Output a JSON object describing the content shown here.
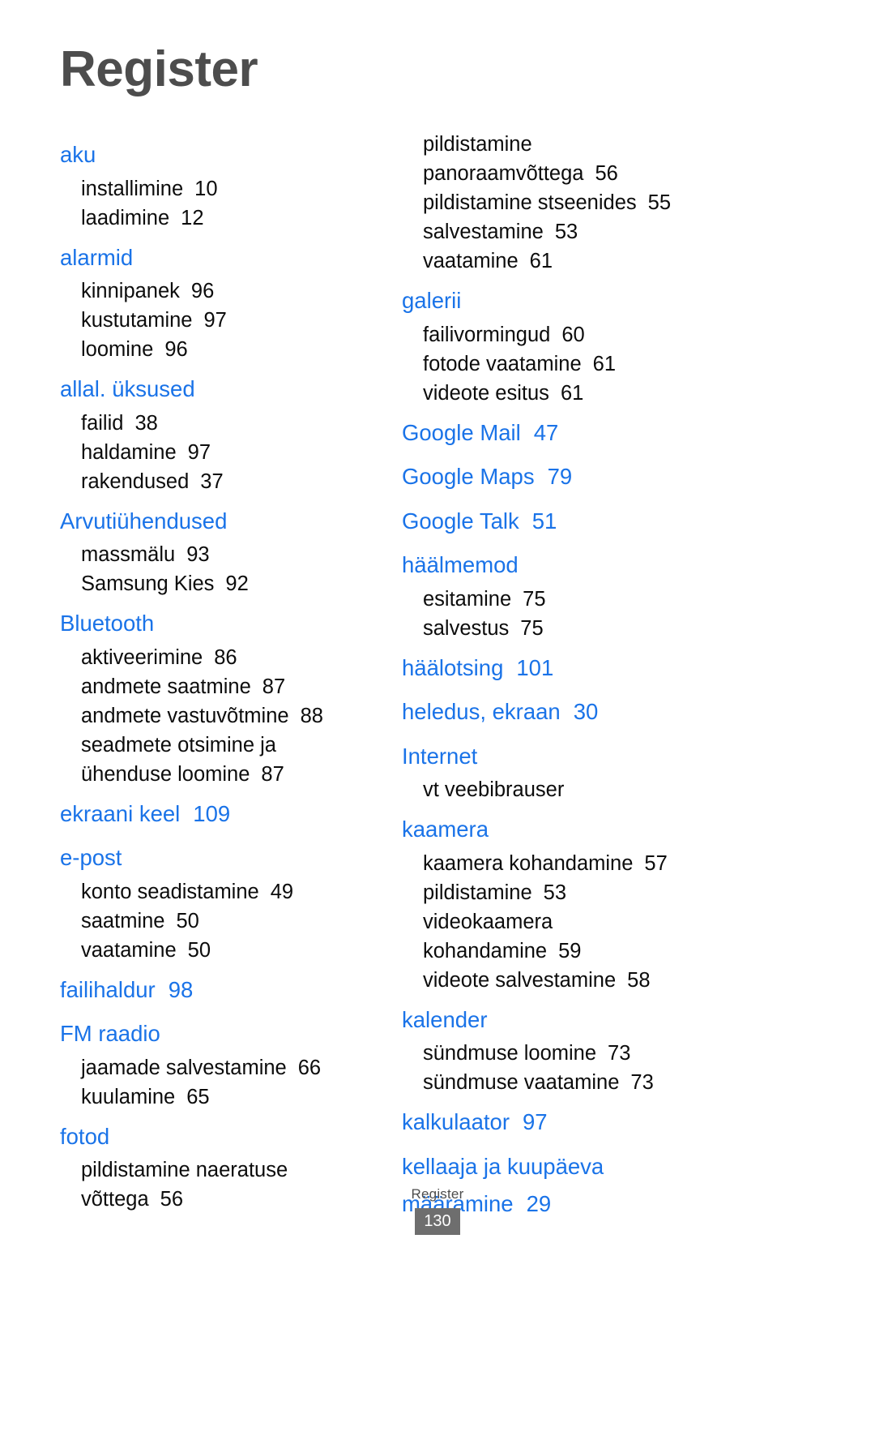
{
  "document": {
    "title": "Register",
    "footer": {
      "label": "Register",
      "page_number": "130"
    },
    "colors": {
      "heading_blue": "#1a73e8",
      "title_gray": "#4d4d4d",
      "body_black": "#0c0c0c",
      "badge_gray": "#6e6e6e",
      "background": "#ffffff"
    }
  },
  "columns": [
    {
      "name": "left-column",
      "groups": [
        {
          "heading": "aku",
          "heading_page": "",
          "subentries": [
            {
              "label": "installimine",
              "page": "10"
            },
            {
              "label": "laadimine",
              "page": "12"
            }
          ]
        },
        {
          "heading": "alarmid",
          "heading_page": "",
          "subentries": [
            {
              "label": "kinnipanek",
              "page": "96"
            },
            {
              "label": "kustutamine",
              "page": "97"
            },
            {
              "label": "loomine",
              "page": "96"
            }
          ]
        },
        {
          "heading": "allal. üksused",
          "heading_page": "",
          "subentries": [
            {
              "label": "failid",
              "page": "38"
            },
            {
              "label": "haldamine",
              "page": "97"
            },
            {
              "label": "rakendused",
              "page": "37"
            }
          ]
        },
        {
          "heading": "Arvutiühendused",
          "heading_page": "",
          "subentries": [
            {
              "label": "massmälu",
              "page": "93"
            },
            {
              "label": "Samsung Kies",
              "page": "92"
            }
          ]
        },
        {
          "heading": "Bluetooth",
          "heading_page": "",
          "subentries": [
            {
              "label": "aktiveerimine",
              "page": "86"
            },
            {
              "label": "andmete saatmine",
              "page": "87"
            },
            {
              "label": "andmete vastuvõtmine",
              "page": "88"
            },
            {
              "label": "seadmete otsimine ja",
              "page": ""
            },
            {
              "label": "ühenduse loomine",
              "page": "87"
            }
          ]
        },
        {
          "heading": "ekraani keel",
          "heading_page": "109",
          "subentries": []
        },
        {
          "heading": "e-post",
          "heading_page": "",
          "subentries": [
            {
              "label": "konto seadistamine",
              "page": "49"
            },
            {
              "label": "saatmine",
              "page": "50"
            },
            {
              "label": "vaatamine",
              "page": "50"
            }
          ]
        },
        {
          "heading": "failihaldur",
          "heading_page": "98",
          "subentries": []
        },
        {
          "heading": "FM raadio",
          "heading_page": "",
          "subentries": [
            {
              "label": "jaamade salvestamine",
              "page": "66"
            },
            {
              "label": "kuulamine",
              "page": "65"
            }
          ]
        },
        {
          "heading": "fotod",
          "heading_page": "",
          "subentries": [
            {
              "label": "pildistamine naeratuse",
              "page": ""
            },
            {
              "label": "võttega",
              "page": "56"
            }
          ]
        }
      ]
    },
    {
      "name": "right-column",
      "groups": [
        {
          "heading": "",
          "heading_page": "",
          "subentries": [
            {
              "label": "pildistamine",
              "page": ""
            },
            {
              "label": "panoraamvõttega",
              "page": "56"
            },
            {
              "label": "pildistamine stseenides",
              "page": "55"
            },
            {
              "label": "salvestamine",
              "page": "53"
            },
            {
              "label": "vaatamine",
              "page": "61"
            }
          ]
        },
        {
          "heading": "galerii",
          "heading_page": "",
          "subentries": [
            {
              "label": "failivormingud",
              "page": "60"
            },
            {
              "label": "fotode vaatamine",
              "page": "61"
            },
            {
              "label": "videote esitus",
              "page": "61"
            }
          ]
        },
        {
          "heading": "Google Mail",
          "heading_page": "47",
          "subentries": []
        },
        {
          "heading": "Google Maps",
          "heading_page": "79",
          "subentries": []
        },
        {
          "heading": "Google Talk",
          "heading_page": "51",
          "subentries": []
        },
        {
          "heading": "häälmemod",
          "heading_page": "",
          "subentries": [
            {
              "label": "esitamine",
              "page": "75"
            },
            {
              "label": "salvestus",
              "page": "75"
            }
          ]
        },
        {
          "heading": "häälotsing",
          "heading_page": "101",
          "subentries": []
        },
        {
          "heading": "heledus, ekraan",
          "heading_page": "30",
          "subentries": []
        },
        {
          "heading": "Internet",
          "heading_page": "",
          "subentries": [
            {
              "label": "vt veebibrauser",
              "page": ""
            }
          ]
        },
        {
          "heading": "kaamera",
          "heading_page": "",
          "subentries": [
            {
              "label": "kaamera kohandamine",
              "page": "57"
            },
            {
              "label": "pildistamine",
              "page": "53"
            },
            {
              "label": "videokaamera",
              "page": ""
            },
            {
              "label": "kohandamine",
              "page": "59"
            },
            {
              "label": "videote salvestamine",
              "page": "58"
            }
          ]
        },
        {
          "heading": "kalender",
          "heading_page": "",
          "subentries": [
            {
              "label": "sündmuse loomine",
              "page": "73"
            },
            {
              "label": "sündmuse vaatamine",
              "page": "73"
            }
          ]
        },
        {
          "heading": "kalkulaator",
          "heading_page": "97",
          "subentries": []
        },
        {
          "heading": "kellaaja ja kuupäeva",
          "heading_page": "",
          "heading_cont": "määramine",
          "heading_cont_page": "29",
          "subentries": []
        }
      ]
    }
  ]
}
